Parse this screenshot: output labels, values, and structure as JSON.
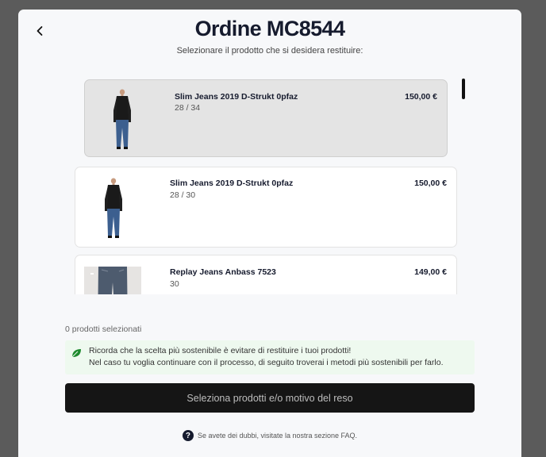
{
  "header": {
    "title": "Ordine MC8544",
    "subtitle": "Selezionare il prodotto che si desidera restituire:"
  },
  "products": [
    {
      "name": "Slim Jeans 2019 D-Strukt 0pfaz",
      "size": "28 / 34",
      "price": "150,00 €",
      "selected": true
    },
    {
      "name": "Slim Jeans 2019 D-Strukt 0pfaz",
      "size": "28 / 30",
      "price": "150,00 €",
      "selected": false
    },
    {
      "name": "Replay Jeans Anbass 7523",
      "size": "30",
      "price": "149,00 €",
      "selected": false
    }
  ],
  "selection": {
    "count_text": "0 prodotti selezionati"
  },
  "notice": {
    "line1": "Ricorda che la scelta più sostenibile è evitare di restituire i tuoi prodotti!",
    "line2": "Nel caso tu voglia continuare con il processo, di seguito troverai i metodi più sostenibili per farlo.",
    "icon": "leaf-icon",
    "color": "#eef9ef"
  },
  "cta": {
    "label": "Seleziona prodotti e/o motivo del reso"
  },
  "faq": {
    "text": "Se avete dei dubbi, visitate la nostra sezione FAQ."
  },
  "colors": {
    "accent": "#151515",
    "title": "#161b2e",
    "leaf": "#1e8a2e"
  }
}
